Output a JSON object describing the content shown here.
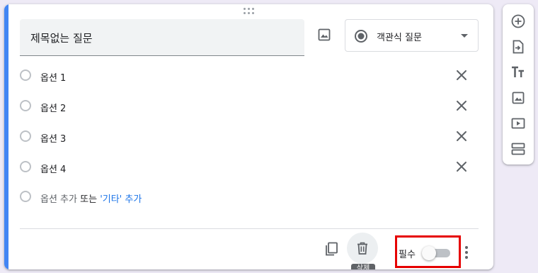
{
  "question": {
    "title": "제목없는 질문",
    "type_label": "객관식 질문",
    "options": [
      {
        "label": "옵션 1"
      },
      {
        "label": "옵션 2"
      },
      {
        "label": "옵션 3"
      },
      {
        "label": "옵션 4"
      }
    ],
    "add_option": {
      "add_label": "옵션 추가",
      "or_label": "또는",
      "etc_label": "'기타' 추가"
    }
  },
  "footer": {
    "required_label": "필수",
    "required_on": false,
    "delete_tooltip": "삭제"
  },
  "toolbar": {
    "tools": [
      "add-question-icon",
      "import-questions-icon",
      "add-title-icon",
      "add-image-icon",
      "add-video-icon",
      "add-section-icon"
    ]
  },
  "colors": {
    "accent": "#4285f4",
    "link": "#1a73e8",
    "highlight_box": "#e60000",
    "background": "#eeeaf6"
  }
}
